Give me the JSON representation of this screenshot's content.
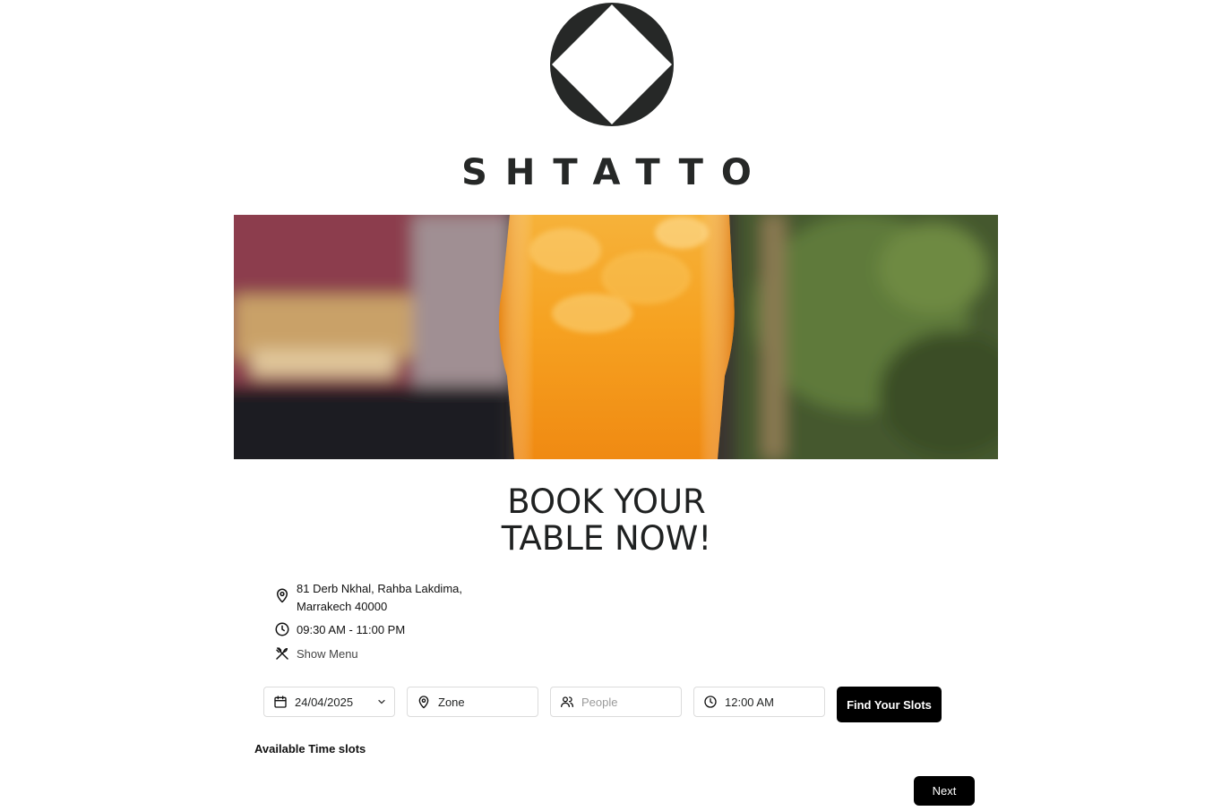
{
  "brand": {
    "name": "SHTATTO"
  },
  "hero": {
    "image_subject": "orange-juice-glass"
  },
  "headline": {
    "line1": "BOOK YOUR",
    "line2": "TABLE NOW!"
  },
  "info": {
    "address_line1": "81 Derb Nkhal, Rahba Lakdima,",
    "address_line2": "Marrakech 40000",
    "hours": "09:30 AM - 11:00 PM",
    "menu_link": "Show Menu"
  },
  "form": {
    "date_value": "24/04/2025",
    "zone_value": "Zone",
    "people_placeholder": "People",
    "time_value": "12:00 AM",
    "find_button": "Find Your Slots"
  },
  "slots": {
    "label": "Available Time slots"
  },
  "footer": {
    "next_button": "Next"
  },
  "icons": {
    "address": "map-pin-icon",
    "hours": "clock-icon",
    "menu": "utensils-icon",
    "date": "calendar-icon",
    "zone": "map-pin-icon",
    "people": "users-icon",
    "time": "clock-icon",
    "dropdown": "chevron-down-icon"
  },
  "colors": {
    "brand_dark": "#262827",
    "button_bg": "#000000",
    "button_text": "#ffffff"
  }
}
